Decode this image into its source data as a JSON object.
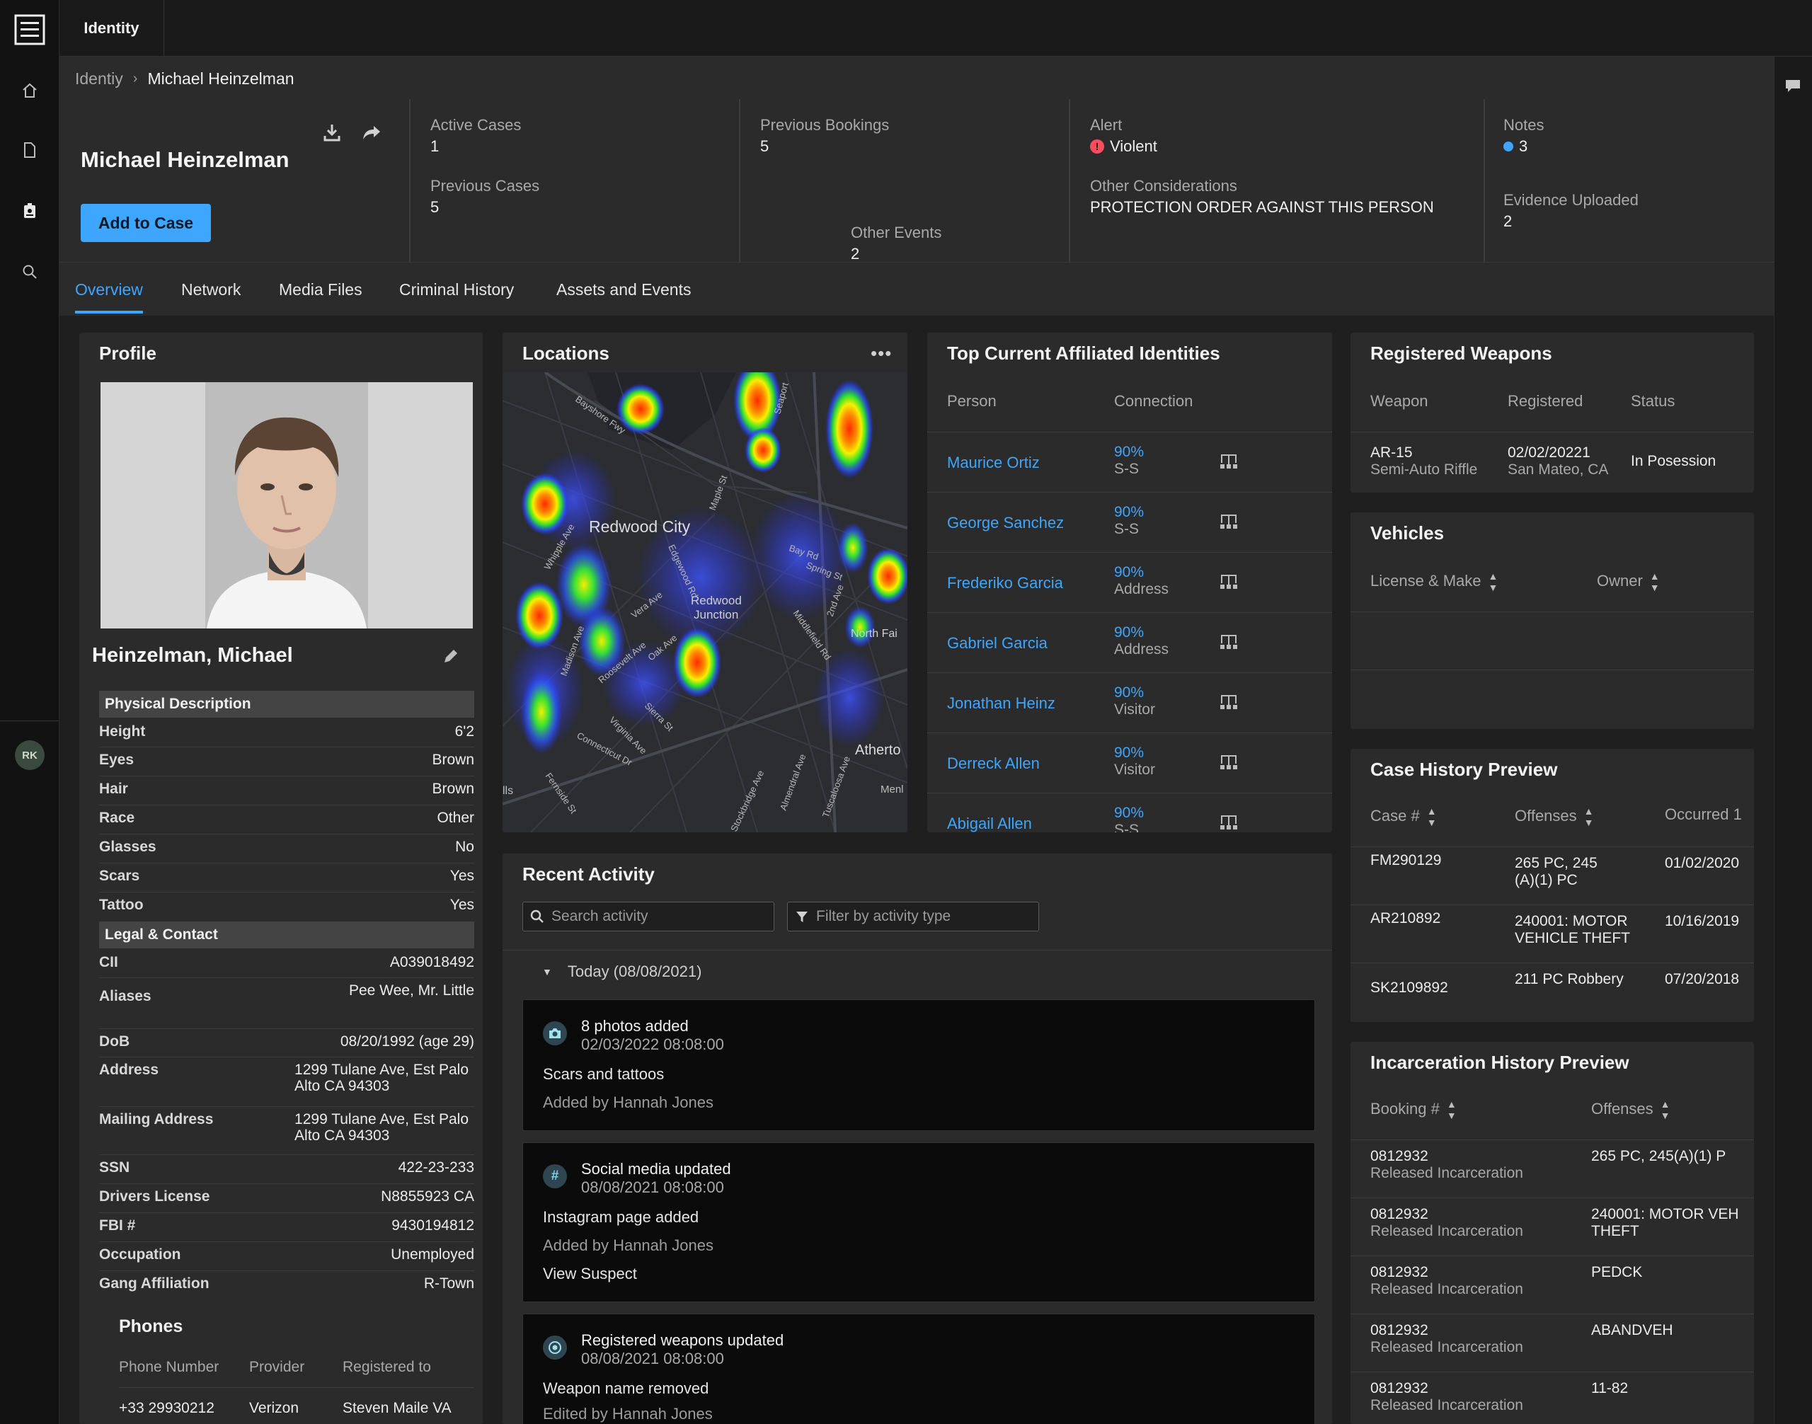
{
  "app": {
    "tab_label": "Identity",
    "avatar_initials": "RK"
  },
  "breadcrumb": {
    "root": "Identiy",
    "current": "Michael Heinzelman"
  },
  "header": {
    "name": "Michael Heinzelman",
    "add_button": "Add to Case",
    "active_cases_label": "Active Cases",
    "active_cases": "1",
    "previous_cases_label": "Previous Cases",
    "previous_cases": "5",
    "previous_bookings_label": "Previous Bookings",
    "previous_bookings": "5",
    "other_events_label": "Other Events",
    "other_events": "2",
    "alert_label": "Alert",
    "alert_value": "Violent",
    "other_considerations_label": "Other Considerations",
    "other_considerations": "PROTECTION ORDER AGAINST THIS PERSON",
    "notes_label": "Notes",
    "notes_value": "3",
    "evidence_label": "Evidence Uploaded",
    "evidence_value": "2"
  },
  "tabs": [
    "Overview",
    "Network",
    "Media Files",
    "Criminal History",
    "Assets and Events"
  ],
  "profile": {
    "title": "Profile",
    "name": "Heinzelman, Michael",
    "physical_head": "Physical Description",
    "physical": [
      {
        "k": "Height",
        "v": "6'2"
      },
      {
        "k": "Eyes",
        "v": "Brown"
      },
      {
        "k": "Hair",
        "v": "Brown"
      },
      {
        "k": "Race",
        "v": "Other"
      },
      {
        "k": "Glasses",
        "v": "No"
      },
      {
        "k": "Scars",
        "v": "Yes"
      },
      {
        "k": "Tattoo",
        "v": "Yes"
      }
    ],
    "legal_head": "Legal & Contact",
    "legal": [
      {
        "k": "CII",
        "v": "A039018492"
      },
      {
        "k": "Aliases",
        "v": "Pee Wee, Mr. Little"
      },
      {
        "k": "DoB",
        "v": "08/20/1992 (age 29)"
      },
      {
        "k": "Address",
        "v1": "1299 Tulane Ave, Est Palo",
        "v2": "Alto CA 94303"
      },
      {
        "k": "Mailing Address",
        "v1": "1299 Tulane Ave, Est Palo",
        "v2": "Alto CA 94303"
      },
      {
        "k": "SSN",
        "v": "422-23-233"
      },
      {
        "k": "Drivers License",
        "v": "N8855923 CA"
      },
      {
        "k": "FBI #",
        "v": "9430194812"
      },
      {
        "k": "Occupation",
        "v": "Unemployed"
      },
      {
        "k": "Gang Affiliation",
        "v": "R-Town"
      }
    ],
    "phones_title": "Phones",
    "phones_cols": [
      "Phone Number",
      "Provider",
      "Registered to"
    ],
    "phones": [
      {
        "number": "+33 29930212",
        "provider": "Verizon",
        "registered_to": "Steven Maile VA"
      }
    ]
  },
  "locations": {
    "title": "Locations",
    "labels": {
      "city": "Redwood City",
      "junction1": "Redwood",
      "junction2": "Junction",
      "atherton": "Atherto",
      "north_fair": "North Fai",
      "menlo": "Menl",
      "hills": "lls",
      "bayshore": "Bayshore Fwy",
      "seaport": "Seaport",
      "maple": "Maple St",
      "bay": "Bay Rd",
      "spring": "Spring St",
      "second": "2nd Ave",
      "middlefield": "Middlefield Rd",
      "vera": "Vera Ave",
      "roosevelt": "Roosevelt Ave",
      "oak": "Oak Ave",
      "madison": "Madison Ave",
      "sierra": "Sierra St",
      "virginia": "Virginia Ave",
      "connecticut": "Connecticut Dr",
      "fernside": "Fernside St",
      "edgewood": "Edgewood Rd",
      "almendral": "Almendral Ave",
      "tuscaloosa": "Tuscaloosa Ave",
      "whipple": "Whipple Ave",
      "stockbridge": "Stockbridge Ave"
    }
  },
  "affiliated": {
    "title": "Top Current Affiliated Identities",
    "cols": [
      "Person",
      "Connection"
    ],
    "rows": [
      {
        "name": "Maurice Ortiz",
        "pct": "90%",
        "type": "S-S"
      },
      {
        "name": "George Sanchez",
        "pct": "90%",
        "type": "S-S"
      },
      {
        "name": "Frederiko Garcia",
        "pct": "90%",
        "type": "Address"
      },
      {
        "name": "Gabriel Garcia",
        "pct": "90%",
        "type": "Address"
      },
      {
        "name": "Jonathan Heinz",
        "pct": "90%",
        "type": "Visitor"
      },
      {
        "name": "Derreck Allen",
        "pct": "90%",
        "type": "Visitor"
      },
      {
        "name": "Abigail Allen",
        "pct": "90%",
        "type": "S-S"
      }
    ]
  },
  "activity": {
    "title": "Recent Activity",
    "search_placeholder": "Search activity",
    "filter_placeholder": "Filter by activity type",
    "day": "Today (08/08/2021)",
    "items": [
      {
        "title": "8 photos added",
        "date": "02/03/2022 08:08:00",
        "body": "Scars and tattoos",
        "by": "Added by Hannah Jones"
      },
      {
        "title": "Social media updated",
        "date": "08/08/2021 08:08:00",
        "body": "Instagram page added",
        "by": "Added by Hannah Jones",
        "link": "View Suspect"
      },
      {
        "title": "Registered weapons updated",
        "date": "08/08/2021 08:08:00",
        "body": "Weapon name removed",
        "by": "Edited by Hannah Jones"
      }
    ]
  },
  "weapons": {
    "title": "Registered Weapons",
    "cols": [
      "Weapon",
      "Registered",
      "Status"
    ],
    "rows": [
      {
        "weapon": "AR-15",
        "weapon_type": "Semi-Auto Riffle",
        "date": "02/02/20221",
        "place": "San Mateo, CA",
        "status": "In Posession"
      }
    ]
  },
  "vehicles": {
    "title": "Vehicles",
    "cols": [
      "License & Make",
      "Owner"
    ]
  },
  "cases": {
    "title": "Case History Preview",
    "cols": [
      "Case #",
      "Offenses",
      "Occurred 1"
    ],
    "rows": [
      {
        "id": "FM290129",
        "off1": "265 PC, 245",
        "off2": "(A)(1) PC",
        "date": "01/02/2020"
      },
      {
        "id": "AR210892",
        "off1": "240001: MOTOR",
        "off2": "VEHICLE THEFT",
        "date": "10/16/2019"
      },
      {
        "id": "SK2109892",
        "off1": "211 PC Robbery",
        "off2": "",
        "date": "07/20/2018"
      }
    ]
  },
  "incarceration": {
    "title": "Incarceration History Preview",
    "cols": [
      "Booking #",
      "Offenses"
    ],
    "rows": [
      {
        "id": "0812932",
        "status": "Released Incarceration",
        "off1": "265 PC, 245(A)(1) P",
        "off2": ""
      },
      {
        "id": "0812932",
        "status": "Released Incarceration",
        "off1": "240001: MOTOR VEH",
        "off2": "THEFT"
      },
      {
        "id": "0812932",
        "status": "Released Incarceration",
        "off1": "PEDCK",
        "off2": ""
      },
      {
        "id": "0812932",
        "status": "Released Incarceration",
        "off1": "ABANDVEH",
        "off2": ""
      },
      {
        "id": "0812932",
        "status": "Released Incarceration",
        "off1": "11-82",
        "off2": ""
      }
    ]
  },
  "icons": {
    "logo": "app-logo-icon",
    "home": "home-icon",
    "document": "document-icon",
    "badge": "badge-icon",
    "search": "search-icon",
    "download": "download-icon",
    "share": "share-icon",
    "edit": "pencil-icon",
    "chat": "chat-icon",
    "network": "network-icon",
    "filter": "filter-icon",
    "camera": "camera-icon",
    "hash": "hash-icon",
    "target": "target-icon"
  },
  "colors": {
    "accent": "#3ea6ff",
    "alert": "#ff4d5e",
    "panel": "#2b2b2b",
    "background": "#1f1f1f"
  }
}
